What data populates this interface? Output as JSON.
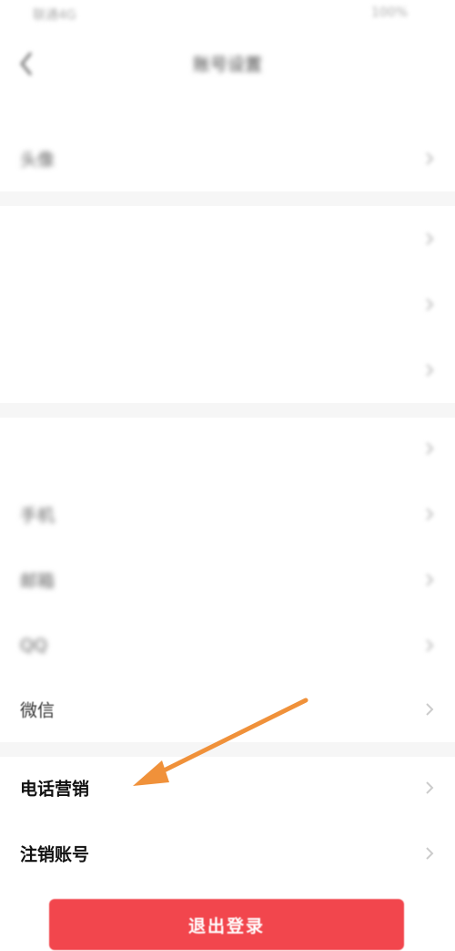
{
  "status_bar": {
    "left": "联通4G",
    "right": "100%"
  },
  "nav": {
    "title": "账号设置",
    "back_icon": "back-arrow-icon"
  },
  "subnote": "",
  "groups": [
    {
      "rows": [
        {
          "label": "头像",
          "value": ""
        }
      ]
    },
    {
      "rows": [
        {
          "label": "",
          "value": ""
        },
        {
          "label": "",
          "value": ""
        },
        {
          "label": "",
          "value": ""
        }
      ]
    },
    {
      "rows": [
        {
          "label": "",
          "value": ""
        },
        {
          "label": "手机",
          "value": ""
        },
        {
          "label": "邮箱",
          "value": ""
        },
        {
          "label": "QQ",
          "value": ""
        },
        {
          "label": "微信",
          "value": ""
        }
      ]
    },
    {
      "rows": [
        {
          "label": "电话营销",
          "value": ""
        },
        {
          "label": "注销账号",
          "value": ""
        }
      ]
    }
  ],
  "logout": {
    "label": "退出登录"
  },
  "colors": {
    "accent": "#f2464d",
    "arrow": "#f0913a",
    "separator": "#f6f6f6"
  }
}
